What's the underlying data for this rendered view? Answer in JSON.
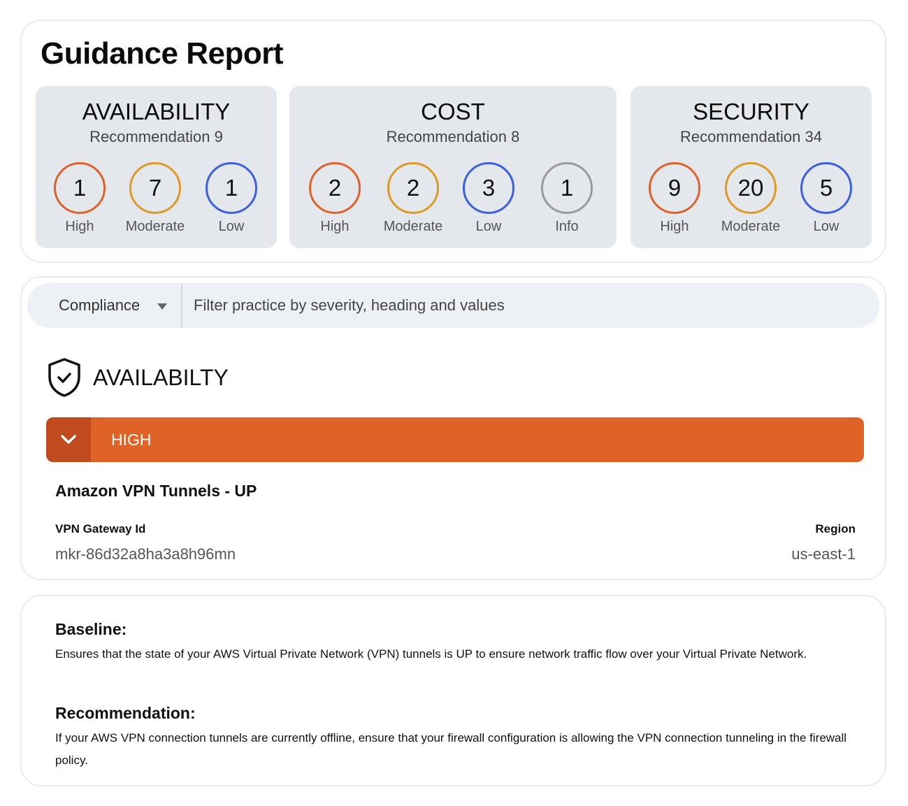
{
  "page_title": "Guidance Report",
  "panels": [
    {
      "title": "AVAILABILITY",
      "subtitle": "Recommendation 9",
      "badges": [
        {
          "count": "1",
          "label": "High",
          "color": "#e0622b"
        },
        {
          "count": "7",
          "label": "Moderate",
          "color": "#dd9a25"
        },
        {
          "count": "1",
          "label": "Low",
          "color": "#3a5fe0"
        }
      ]
    },
    {
      "title": "COST",
      "subtitle": "Recommendation 8",
      "badges": [
        {
          "count": "2",
          "label": "High",
          "color": "#e0622b"
        },
        {
          "count": "2",
          "label": "Moderate",
          "color": "#dd9a25"
        },
        {
          "count": "3",
          "label": "Low",
          "color": "#3a5fe0"
        },
        {
          "count": "1",
          "label": "Info",
          "color": "#9a9a9a"
        }
      ]
    },
    {
      "title": "SECURITY",
      "subtitle": "Recommendation 34",
      "badges": [
        {
          "count": "9",
          "label": "High",
          "color": "#e0622b"
        },
        {
          "count": "20",
          "label": "Moderate",
          "color": "#dd9a25"
        },
        {
          "count": "5",
          "label": "Low",
          "color": "#3a5fe0"
        }
      ]
    }
  ],
  "filter": {
    "category": "Compliance",
    "search_placeholder": "Filter practice by severity, heading and values"
  },
  "section": {
    "icon": "shield-check-icon",
    "title": "AVAILABILTY",
    "severity": "HIGH",
    "severity_color": "#df6326"
  },
  "item": {
    "title": "Amazon VPN Tunnels - UP",
    "gateway_key": "VPN Gateway Id",
    "gateway_value": "mkr-86d32a8ha3a8h96mn",
    "region_key": "Region",
    "region_value": "us-east-1"
  },
  "info": {
    "baseline_heading": "Baseline:",
    "baseline_text": "Ensures that the state of your AWS Virtual Private Network (VPN) tunnels is UP to ensure network traffic flow over your Virtual Private Network.",
    "recommendation_heading": "Recommendation:",
    "recommendation_text": "If your AWS VPN connection tunnels are currently offline, ensure that your firewall configuration is allowing the VPN connection tunneling in the firewall policy."
  }
}
